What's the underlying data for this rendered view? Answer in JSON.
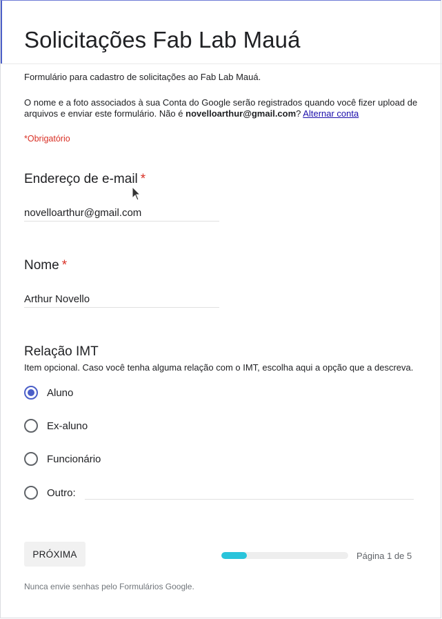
{
  "form": {
    "title": "Solicitações Fab Lab Mauá",
    "description": "Formulário para cadastro de solicitações ao Fab Lab Mauá.",
    "notice_prefix": "O nome e a foto associados à sua Conta do Google serão registrados quando você fizer upload de arquivos e enviar este formulário. Não é ",
    "notice_email": "novelloarthur@gmail.com",
    "notice_suffix": "? ",
    "switch_account_label": "Alternar conta",
    "required_note": "*Obrigatório"
  },
  "questions": {
    "email": {
      "label": "Endereço de e-mail",
      "required_mark": "*",
      "value": "novelloarthur@gmail.com"
    },
    "name": {
      "label": "Nome",
      "required_mark": "*",
      "value": "Arthur Novello"
    },
    "relation": {
      "label": "Relação IMT",
      "helper": "Item opcional. Caso você tenha alguma relação com o IMT, escolha aqui a opção que a descreva.",
      "options": [
        "Aluno",
        "Ex-aluno",
        "Funcionário",
        "Outro:"
      ],
      "selected": "Aluno",
      "other_value": ""
    }
  },
  "navigation": {
    "next_label": "PRÓXIMA",
    "progress_fraction": 0.2,
    "page_indicator": "Página 1 de 5"
  },
  "footer": {
    "text": "Nunca envie senhas pelo Formulários Google."
  },
  "colors": {
    "accent": "#4b5fc8",
    "required": "#d93025",
    "progress": "#29c4db",
    "link": "#1a0dab"
  }
}
